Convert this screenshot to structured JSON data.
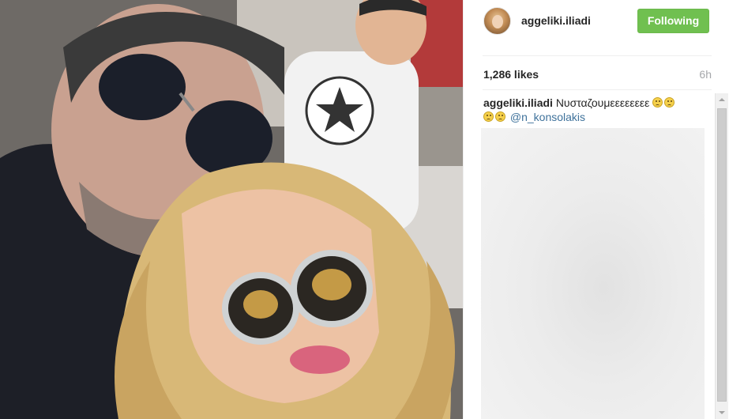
{
  "post": {
    "username": "aggeliki.iliadi",
    "follow_label": "Following",
    "likes": "1,286 likes",
    "time_ago": "6h",
    "caption_author": "aggeliki.iliadi",
    "caption_text": "Νυσταζουμεεεεεεεε",
    "caption_mention": "@n_konsolakis"
  },
  "icons": {
    "emoji": "worried-face-emoji",
    "avatar": "profile-avatar"
  },
  "colors": {
    "follow_button": "#70c050",
    "mention": "#3f729b",
    "muted_text": "#a5a7aa"
  }
}
